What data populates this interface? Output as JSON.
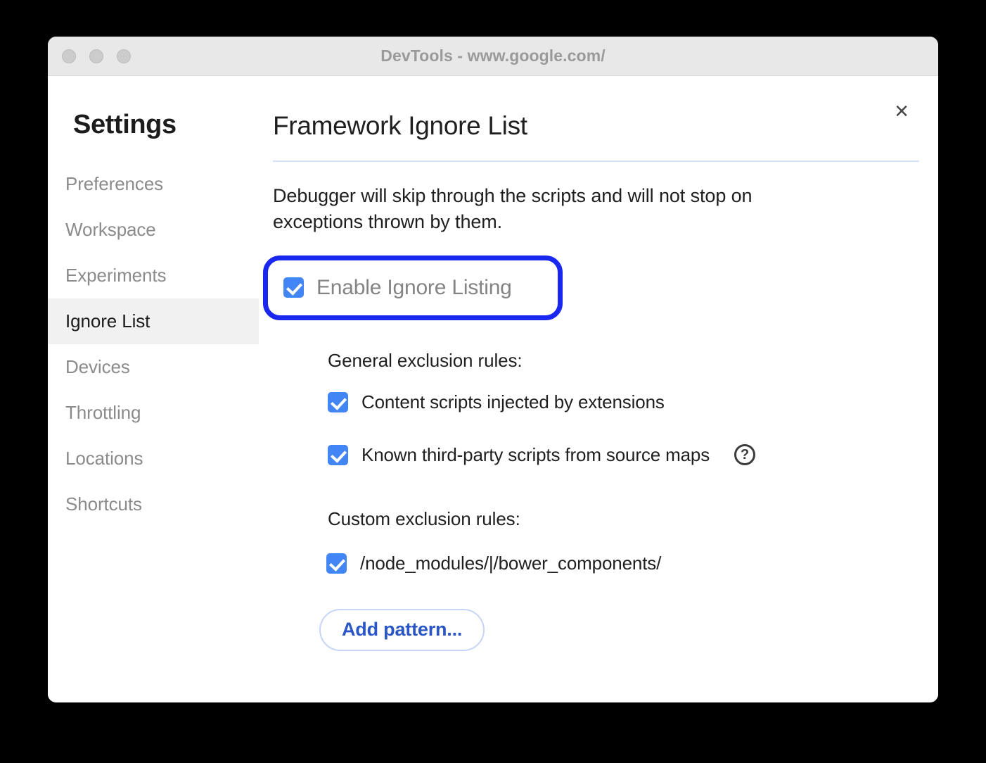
{
  "window": {
    "title": "DevTools - www.google.com/",
    "traffic_lights": [
      "close-dot",
      "minimize-dot",
      "zoom-dot"
    ]
  },
  "sidebar": {
    "heading": "Settings",
    "items": [
      {
        "label": "Preferences",
        "selected": false
      },
      {
        "label": "Workspace",
        "selected": false
      },
      {
        "label": "Experiments",
        "selected": false
      },
      {
        "label": "Ignore List",
        "selected": true
      },
      {
        "label": "Devices",
        "selected": false
      },
      {
        "label": "Throttling",
        "selected": false
      },
      {
        "label": "Locations",
        "selected": false
      },
      {
        "label": "Shortcuts",
        "selected": false
      }
    ]
  },
  "main": {
    "title": "Framework Ignore List",
    "close_label": "×",
    "description": "Debugger will skip through the scripts and will not stop on exceptions thrown by them.",
    "enable_ignore_listing": {
      "label": "Enable Ignore Listing",
      "checked": true,
      "highlighted": true
    },
    "general_rules_label": "General exclusion rules:",
    "general_rules": [
      {
        "label": "Content scripts injected by extensions",
        "checked": true,
        "help": false
      },
      {
        "label": "Known third-party scripts from source maps",
        "checked": true,
        "help": true
      }
    ],
    "help_glyph": "?",
    "custom_rules_label": "Custom exclusion rules:",
    "custom_rules": [
      {
        "label": "/node_modules/|/bower_components/",
        "checked": true
      }
    ],
    "add_pattern_label": "Add pattern..."
  },
  "colors": {
    "accent_checkbox": "#4285f4",
    "highlight_ring": "#1a27f0",
    "link_blue": "#2a56c6",
    "divider_blue": "#d6e0fb",
    "selected_row_bg": "#f1f1f1",
    "titlebar_bg": "#e8e8e8",
    "page_bg": "#000000"
  }
}
